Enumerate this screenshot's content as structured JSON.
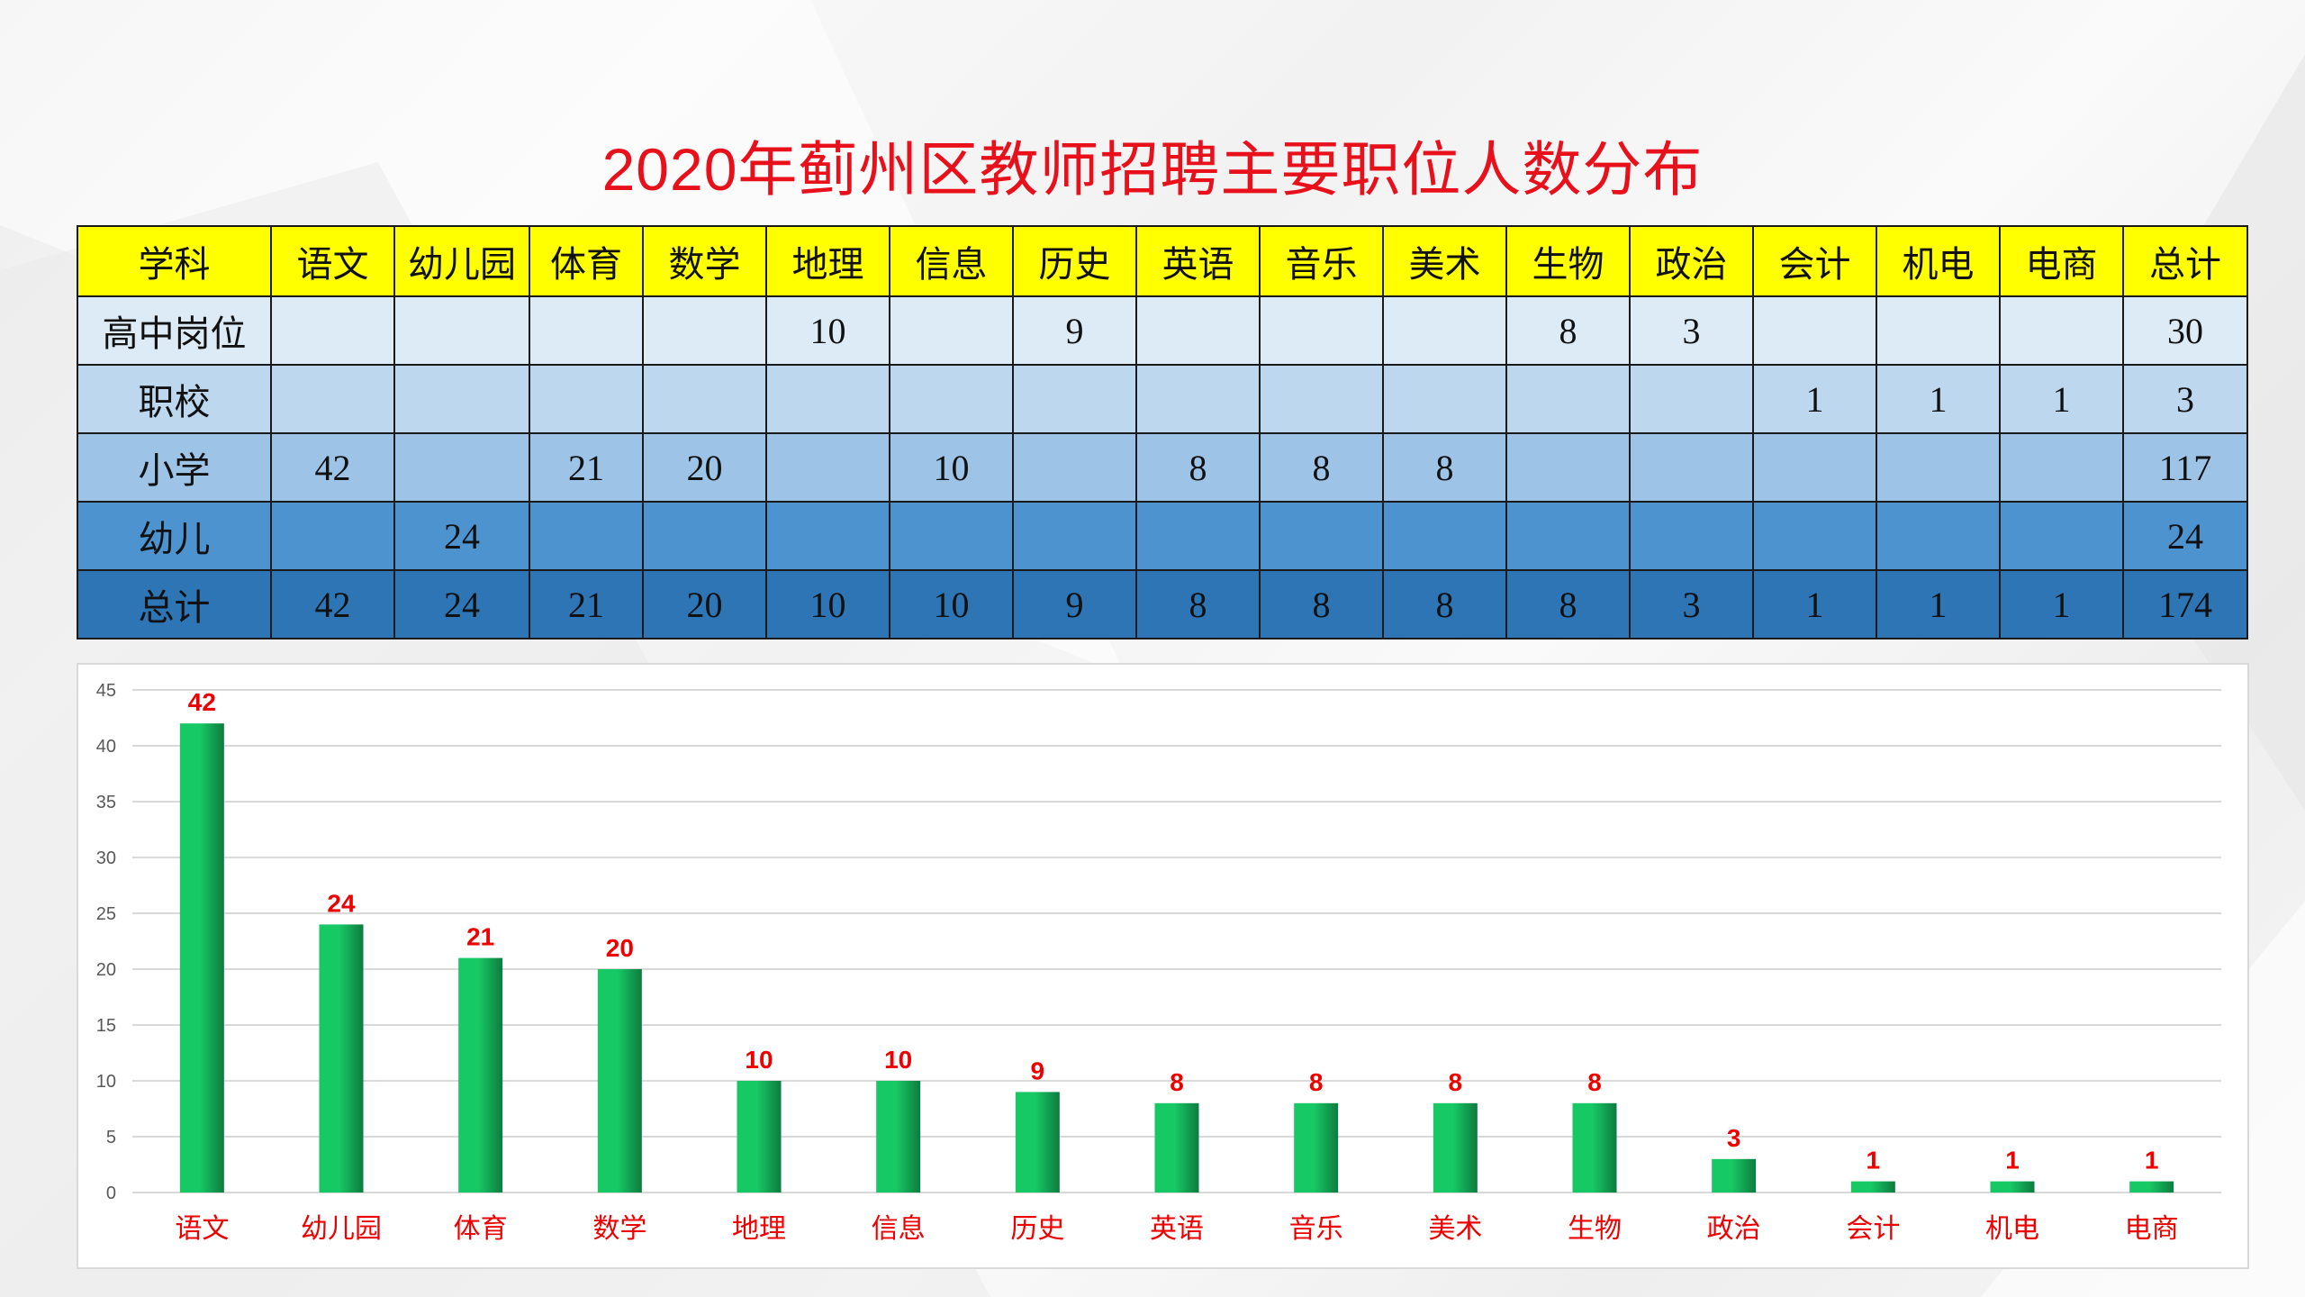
{
  "title": "2020年蓟州区教师招聘主要职位人数分布",
  "table": {
    "header": [
      "学科",
      "语文",
      "幼儿园",
      "体育",
      "数学",
      "地理",
      "信息",
      "历史",
      "英语",
      "音乐",
      "美术",
      "生物",
      "政治",
      "会计",
      "机电",
      "电商",
      "总计"
    ],
    "rows": [
      [
        "高中岗位",
        "",
        "",
        "",
        "",
        "10",
        "",
        "9",
        "",
        "",
        "",
        "8",
        "3",
        "",
        "",
        "",
        "30"
      ],
      [
        "职校",
        "",
        "",
        "",
        "",
        "",
        "",
        "",
        "",
        "",
        "",
        "",
        "",
        "1",
        "1",
        "1",
        "3"
      ],
      [
        "小学",
        "42",
        "",
        "21",
        "20",
        "",
        "10",
        "",
        "8",
        "8",
        "8",
        "",
        "",
        "",
        "",
        "",
        "117"
      ],
      [
        "幼儿",
        "",
        "24",
        "",
        "",
        "",
        "",
        "",
        "",
        "",
        "",
        "",
        "",
        "",
        "",
        "",
        "24"
      ],
      [
        "总计",
        "42",
        "24",
        "21",
        "20",
        "10",
        "10",
        "9",
        "8",
        "8",
        "8",
        "8",
        "3",
        "1",
        "1",
        "1",
        "174"
      ]
    ]
  },
  "colors": {
    "title": "#e8101a",
    "header_bg": "#ffff00",
    "row_bgs": [
      "#ddebf7",
      "#bdd7ee",
      "#9dc3e6",
      "#4d93d0",
      "#2e75b6"
    ],
    "bar_light": "#17c964",
    "bar_dark": "#0e7a40",
    "label": "#ee0000",
    "grid": "#d9d9d9",
    "tick": "#595959"
  },
  "chart_data": {
    "type": "bar",
    "title": "",
    "xlabel": "",
    "ylabel": "",
    "categories": [
      "语文",
      "幼儿园",
      "体育",
      "数学",
      "地理",
      "信息",
      "历史",
      "英语",
      "音乐",
      "美术",
      "生物",
      "政治",
      "会计",
      "机电",
      "电商"
    ],
    "values": [
      42,
      24,
      21,
      20,
      10,
      10,
      9,
      8,
      8,
      8,
      8,
      3,
      1,
      1,
      1
    ],
    "ylim": [
      0,
      45
    ],
    "yticks": [
      0,
      5,
      10,
      15,
      20,
      25,
      30,
      35,
      40,
      45
    ],
    "grid": true,
    "legend": "none",
    "data_labels": true
  }
}
